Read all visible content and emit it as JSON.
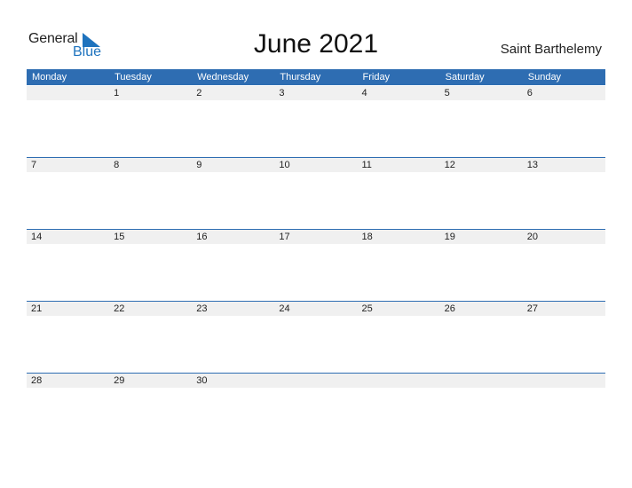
{
  "logo": {
    "line1": "General",
    "line2": "Blue"
  },
  "title": "June 2021",
  "country": "Saint Barthelemy",
  "colors": {
    "accent": "#2e6db2",
    "row_bg": "#f0f0f0",
    "logo_blue": "#1e73be"
  },
  "weekdays": [
    "Monday",
    "Tuesday",
    "Wednesday",
    "Thursday",
    "Friday",
    "Saturday",
    "Sunday"
  ],
  "weeks": [
    [
      "",
      "1",
      "2",
      "3",
      "4",
      "5",
      "6"
    ],
    [
      "7",
      "8",
      "9",
      "10",
      "11",
      "12",
      "13"
    ],
    [
      "14",
      "15",
      "16",
      "17",
      "18",
      "19",
      "20"
    ],
    [
      "21",
      "22",
      "23",
      "24",
      "25",
      "26",
      "27"
    ],
    [
      "28",
      "29",
      "30",
      "",
      "",
      "",
      ""
    ]
  ]
}
